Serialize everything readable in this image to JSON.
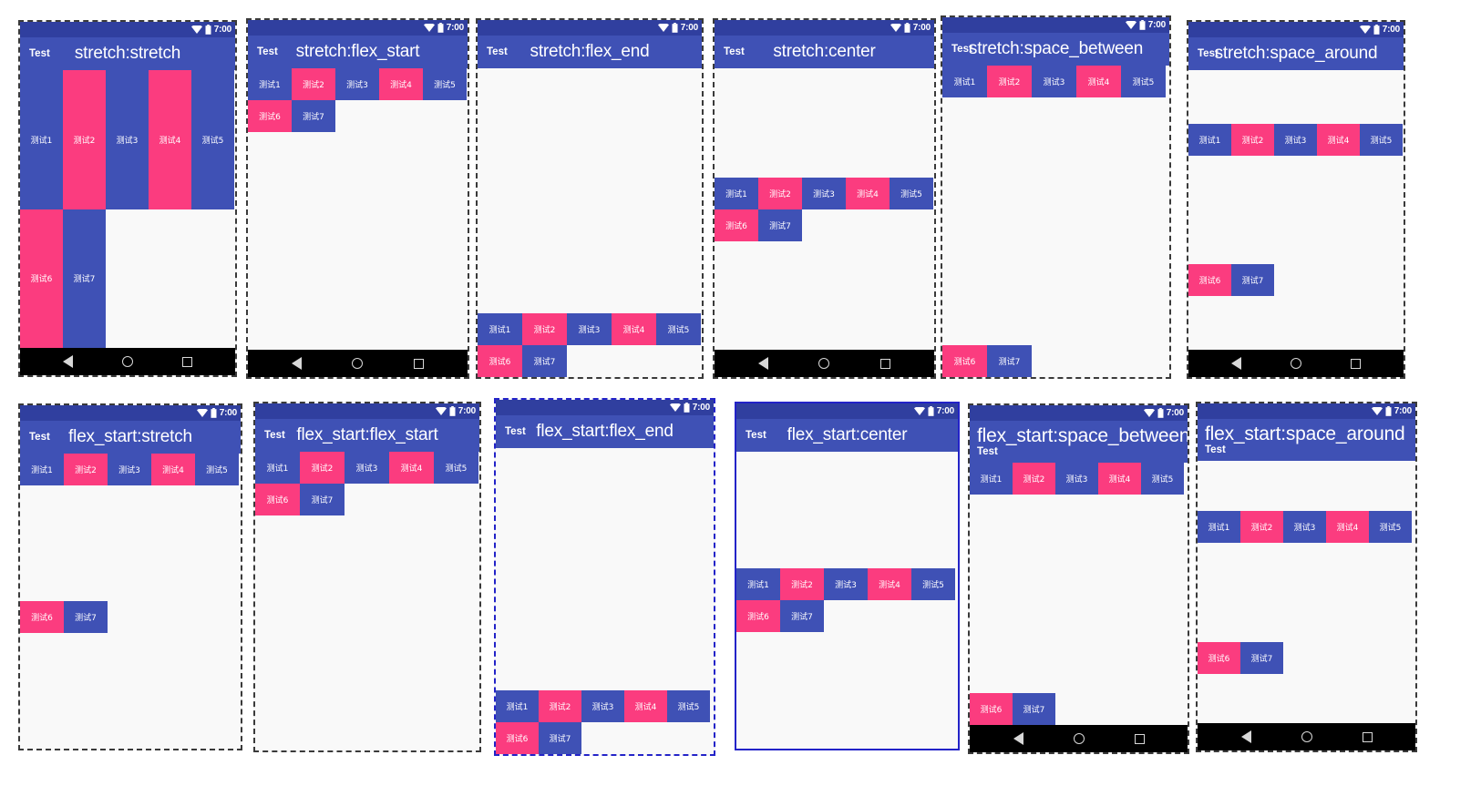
{
  "meta": {
    "app_name": "Test",
    "status_time": "7:00",
    "icons": {
      "wifi": "wifi-icon",
      "battery": "battery-icon",
      "back": "back-triangle-icon",
      "home": "home-circle-icon",
      "recents": "recents-square-icon"
    }
  },
  "colors": {
    "status_bar": "#303F9F",
    "app_bar": "#3F51B5",
    "item_blue": "#3F51B5",
    "item_pink": "#FB3C7F",
    "content_bg": "#F9F9F9",
    "nav_bar": "#000000",
    "selection_dash": "#3A3A3A",
    "selection_blue": "#2323C8"
  },
  "items": [
    {
      "label": "测试1",
      "color": "blue"
    },
    {
      "label": "测试2",
      "color": "pink"
    },
    {
      "label": "测试3",
      "color": "blue"
    },
    {
      "label": "测试4",
      "color": "pink"
    },
    {
      "label": "测试5",
      "color": "blue"
    },
    {
      "label": "测试6",
      "color": "pink"
    },
    {
      "label": "测试7",
      "color": "blue"
    }
  ],
  "panels": [
    {
      "id": "p1",
      "title": "stretch:stretch",
      "align_items": "stretch",
      "align_content": "stretch",
      "title_mode": "centered",
      "frame": "dash",
      "navbar": true
    },
    {
      "id": "p2",
      "title": "stretch:flex_start",
      "align_items": "stretch",
      "align_content": "flex_start",
      "title_mode": "centered",
      "frame": "dash",
      "navbar": true
    },
    {
      "id": "p3",
      "title": "stretch:flex_end",
      "align_items": "stretch",
      "align_content": "flex_end",
      "title_mode": "centered",
      "frame": "dash",
      "navbar": false
    },
    {
      "id": "p4",
      "title": "stretch:center",
      "align_items": "stretch",
      "align_content": "center",
      "title_mode": "centered",
      "frame": "dash",
      "navbar": true
    },
    {
      "id": "p5",
      "title": "stretch:space_between",
      "align_items": "stretch",
      "align_content": "space_between",
      "title_mode": "overlap",
      "frame": "dash",
      "navbar": false
    },
    {
      "id": "p6",
      "title": "stretch:space_around",
      "align_items": "stretch",
      "align_content": "space_around",
      "title_mode": "overlap",
      "frame": "dash",
      "navbar": true
    },
    {
      "id": "p7",
      "title": "flex_start:stretch",
      "align_items": "flex_start",
      "align_content": "stretch",
      "title_mode": "centered",
      "frame": "dash",
      "navbar": false
    },
    {
      "id": "p8",
      "title": "flex_start:flex_start",
      "align_items": "flex_start",
      "align_content": "flex_start",
      "title_mode": "centered",
      "frame": "dash",
      "navbar": false
    },
    {
      "id": "p9",
      "title": "flex_start:flex_end",
      "align_items": "flex_start",
      "align_content": "flex_end",
      "title_mode": "centered",
      "frame": "bluedash",
      "navbar": false
    },
    {
      "id": "p10",
      "title": "flex_start:center",
      "align_items": "flex_start",
      "align_content": "center",
      "title_mode": "centered",
      "frame": "blue",
      "navbar": false
    },
    {
      "id": "p11",
      "title": "flex_start:space_between",
      "align_items": "flex_start",
      "align_content": "space_between",
      "title_mode": "stacked",
      "frame": "dash",
      "navbar": true
    },
    {
      "id": "p12",
      "title": "flex_start:space_around",
      "align_items": "flex_start",
      "align_content": "space_around",
      "title_mode": "stacked",
      "frame": "dash",
      "navbar": true
    }
  ]
}
